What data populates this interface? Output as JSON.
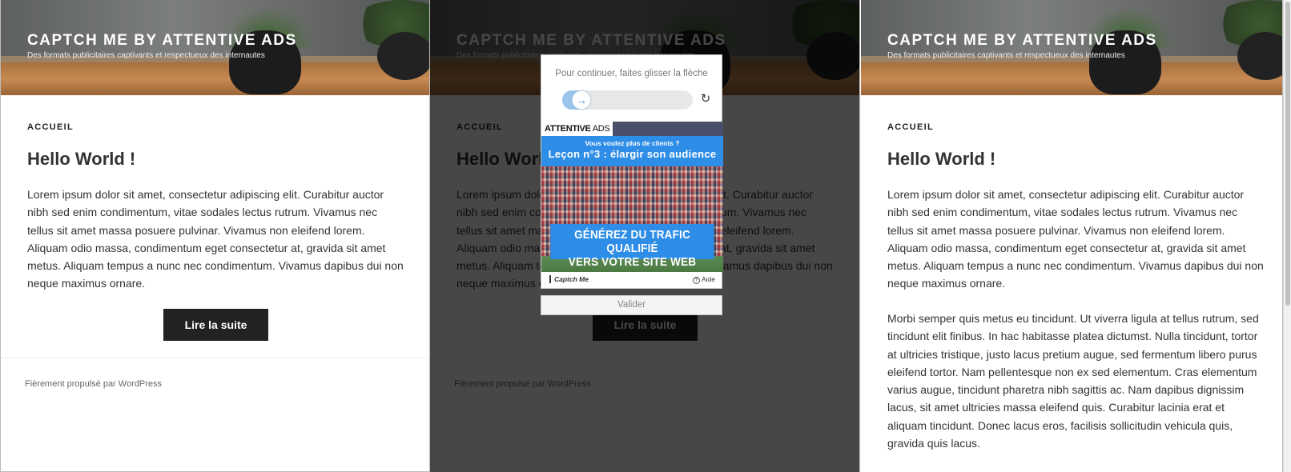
{
  "site": {
    "title": "CAPTCH ME BY ATTENTIVE ADS",
    "description": "Des formats publicitaires captivants et respectueux des internautes"
  },
  "nav": {
    "home_label": "ACCUEIL"
  },
  "post": {
    "title": "Hello World !",
    "paragraph1": "Lorem ipsum dolor sit amet, consectetur adipiscing elit. Curabitur auctor nibh sed enim condimentum, vitae sodales lectus rutrum. Vivamus nec tellus sit amet massa posuere pulvinar. Vivamus non eleifend lorem. Aliquam odio massa, condimentum eget consectetur at, gravida sit amet metus. Aliquam tempus a nunc nec condimentum. Vivamus dapibus dui non neque maximus ornare.",
    "paragraph2": "Morbi semper quis metus eu tincidunt. Ut viverra ligula at tellus rutrum, sed tincidunt elit finibus. In hac habitasse platea dictumst. Nulla tincidunt, tortor at ultricies tristique, justo lacus pretium augue, sed fermentum libero purus eleifend tortor. Nam pellentesque non ex sed elementum. Cras elementum varius augue, tincidunt pharetra nibh sagittis ac. Nam dapibus dignissim lacus, sit amet ultricies massa eleifend quis. Curabitur lacinia erat et aliquam tincidunt. Donec lacus eros, facilisis sollicitudin vehicula quis, gravida quis lacus.",
    "read_more_label": "Lire la suite"
  },
  "footer": {
    "text": "Fièrement propulsé par WordPress"
  },
  "captcha": {
    "instruction": "Pour continuer, faites glisser la flèche",
    "slider_icon": "arrow-right-icon",
    "slider_glyph": "→",
    "slider_progress": 0.12,
    "refresh_icon": "refresh-icon",
    "refresh_glyph": "↻",
    "ad": {
      "brand_bold": "ATTENTIVE",
      "brand_light": " ADS",
      "question": "Vous voulez plus de clients ?",
      "lesson": "Leçon n°3 : élargir son audience",
      "headline_line1": "GÉNÉREZ DU TRAFIC QUALIFIÉ",
      "headline_line2": "VERS VOTRE SITE WEB"
    },
    "footer_brand": "Captch Me",
    "help_label": "Aide",
    "help_glyph": "?",
    "validate_label": "Valider"
  },
  "colors": {
    "overlay": "#000000",
    "button": "#222222",
    "accent_blue": "#2e8de6"
  }
}
